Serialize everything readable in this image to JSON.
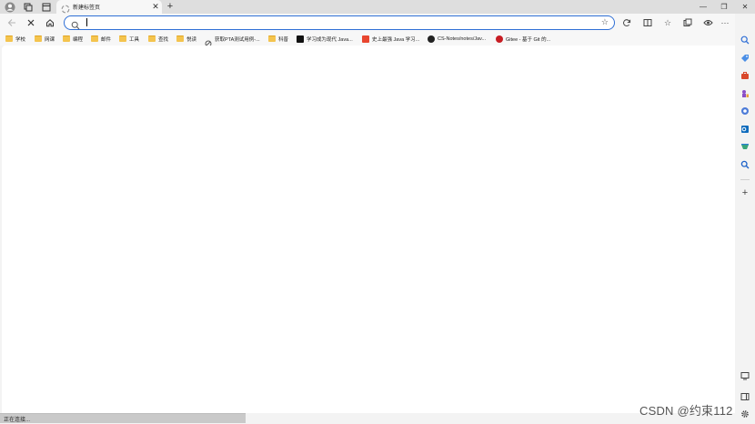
{
  "tab": {
    "title": "新建标签页"
  },
  "address_bar": {
    "value": "",
    "placeholder": ""
  },
  "bookmarks": [
    {
      "label": "学校",
      "icon": "folder-icon"
    },
    {
      "label": "网课",
      "icon": "folder-icon"
    },
    {
      "label": "编程",
      "icon": "folder-icon"
    },
    {
      "label": "邮件",
      "icon": "folder-icon"
    },
    {
      "label": "工具",
      "icon": "folder-icon"
    },
    {
      "label": "查找",
      "icon": "folder-icon"
    },
    {
      "label": "悦读",
      "icon": "folder-icon"
    },
    {
      "label": "获取PTA测试用例-...",
      "icon": "pta-icon"
    },
    {
      "label": "科普",
      "icon": "folder-icon"
    },
    {
      "label": "学习成为现代 Java...",
      "icon": "java-icon"
    },
    {
      "label": "史上最强 Java 学习...",
      "icon": "csdn-icon"
    },
    {
      "label": "CS-Notes/notes/Jav...",
      "icon": "github-icon"
    },
    {
      "label": "Gitee - 基于 Git 的...",
      "icon": "gitee-icon"
    }
  ],
  "status_text": "正在连接...",
  "watermark": "CSDN @约束112",
  "colors": {
    "accent": "#2f6fd6",
    "folder": "#f4c44e"
  }
}
